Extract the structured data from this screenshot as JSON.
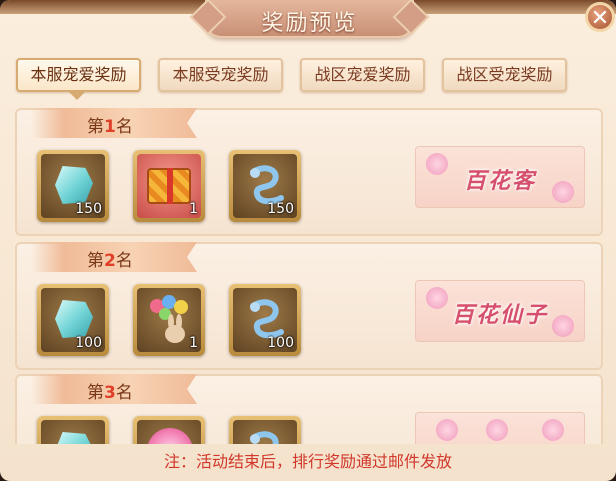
{
  "window": {
    "title": "奖励预览",
    "close_label": "✕"
  },
  "tabs": [
    {
      "label": "本服宠爱奖励",
      "active": true
    },
    {
      "label": "本服受宠奖励",
      "active": false
    },
    {
      "label": "战区宠爱奖励",
      "active": false
    },
    {
      "label": "战区受宠奖励",
      "active": false
    }
  ],
  "ranks": [
    {
      "prefix": "第",
      "number": "1",
      "suffix": "名",
      "items": [
        {
          "icon": "crystal-gem-icon",
          "qty": "150",
          "bg": "gold"
        },
        {
          "icon": "gift-box-icon",
          "qty": "1",
          "bg": "red"
        },
        {
          "icon": "blue-dragon-icon",
          "qty": "150",
          "bg": "gold"
        }
      ],
      "title_banner": "百花客"
    },
    {
      "prefix": "第",
      "number": "2",
      "suffix": "名",
      "items": [
        {
          "icon": "crystal-gem-icon",
          "qty": "100",
          "bg": "gold"
        },
        {
          "icon": "balloon-bunny-icon",
          "qty": "1",
          "bg": "gold"
        },
        {
          "icon": "blue-dragon-icon",
          "qty": "100",
          "bg": "gold"
        }
      ],
      "title_banner": "百花仙子"
    },
    {
      "prefix": "第",
      "number": "3",
      "suffix": "名",
      "items": [
        {
          "icon": "crystal-gem-icon",
          "qty": "",
          "bg": "gold"
        },
        {
          "icon": "pink-flower-icon",
          "qty": "",
          "bg": "gold"
        },
        {
          "icon": "blue-dragon-icon",
          "qty": "",
          "bg": "gold"
        }
      ],
      "title_banner": ""
    }
  ],
  "footer": {
    "note": "注：活动结束后，排行奖励通过邮件发放"
  },
  "colors": {
    "accent_red": "#d1382a",
    "rank_number": "#e0402a",
    "tab_text": "#7a3a20"
  }
}
